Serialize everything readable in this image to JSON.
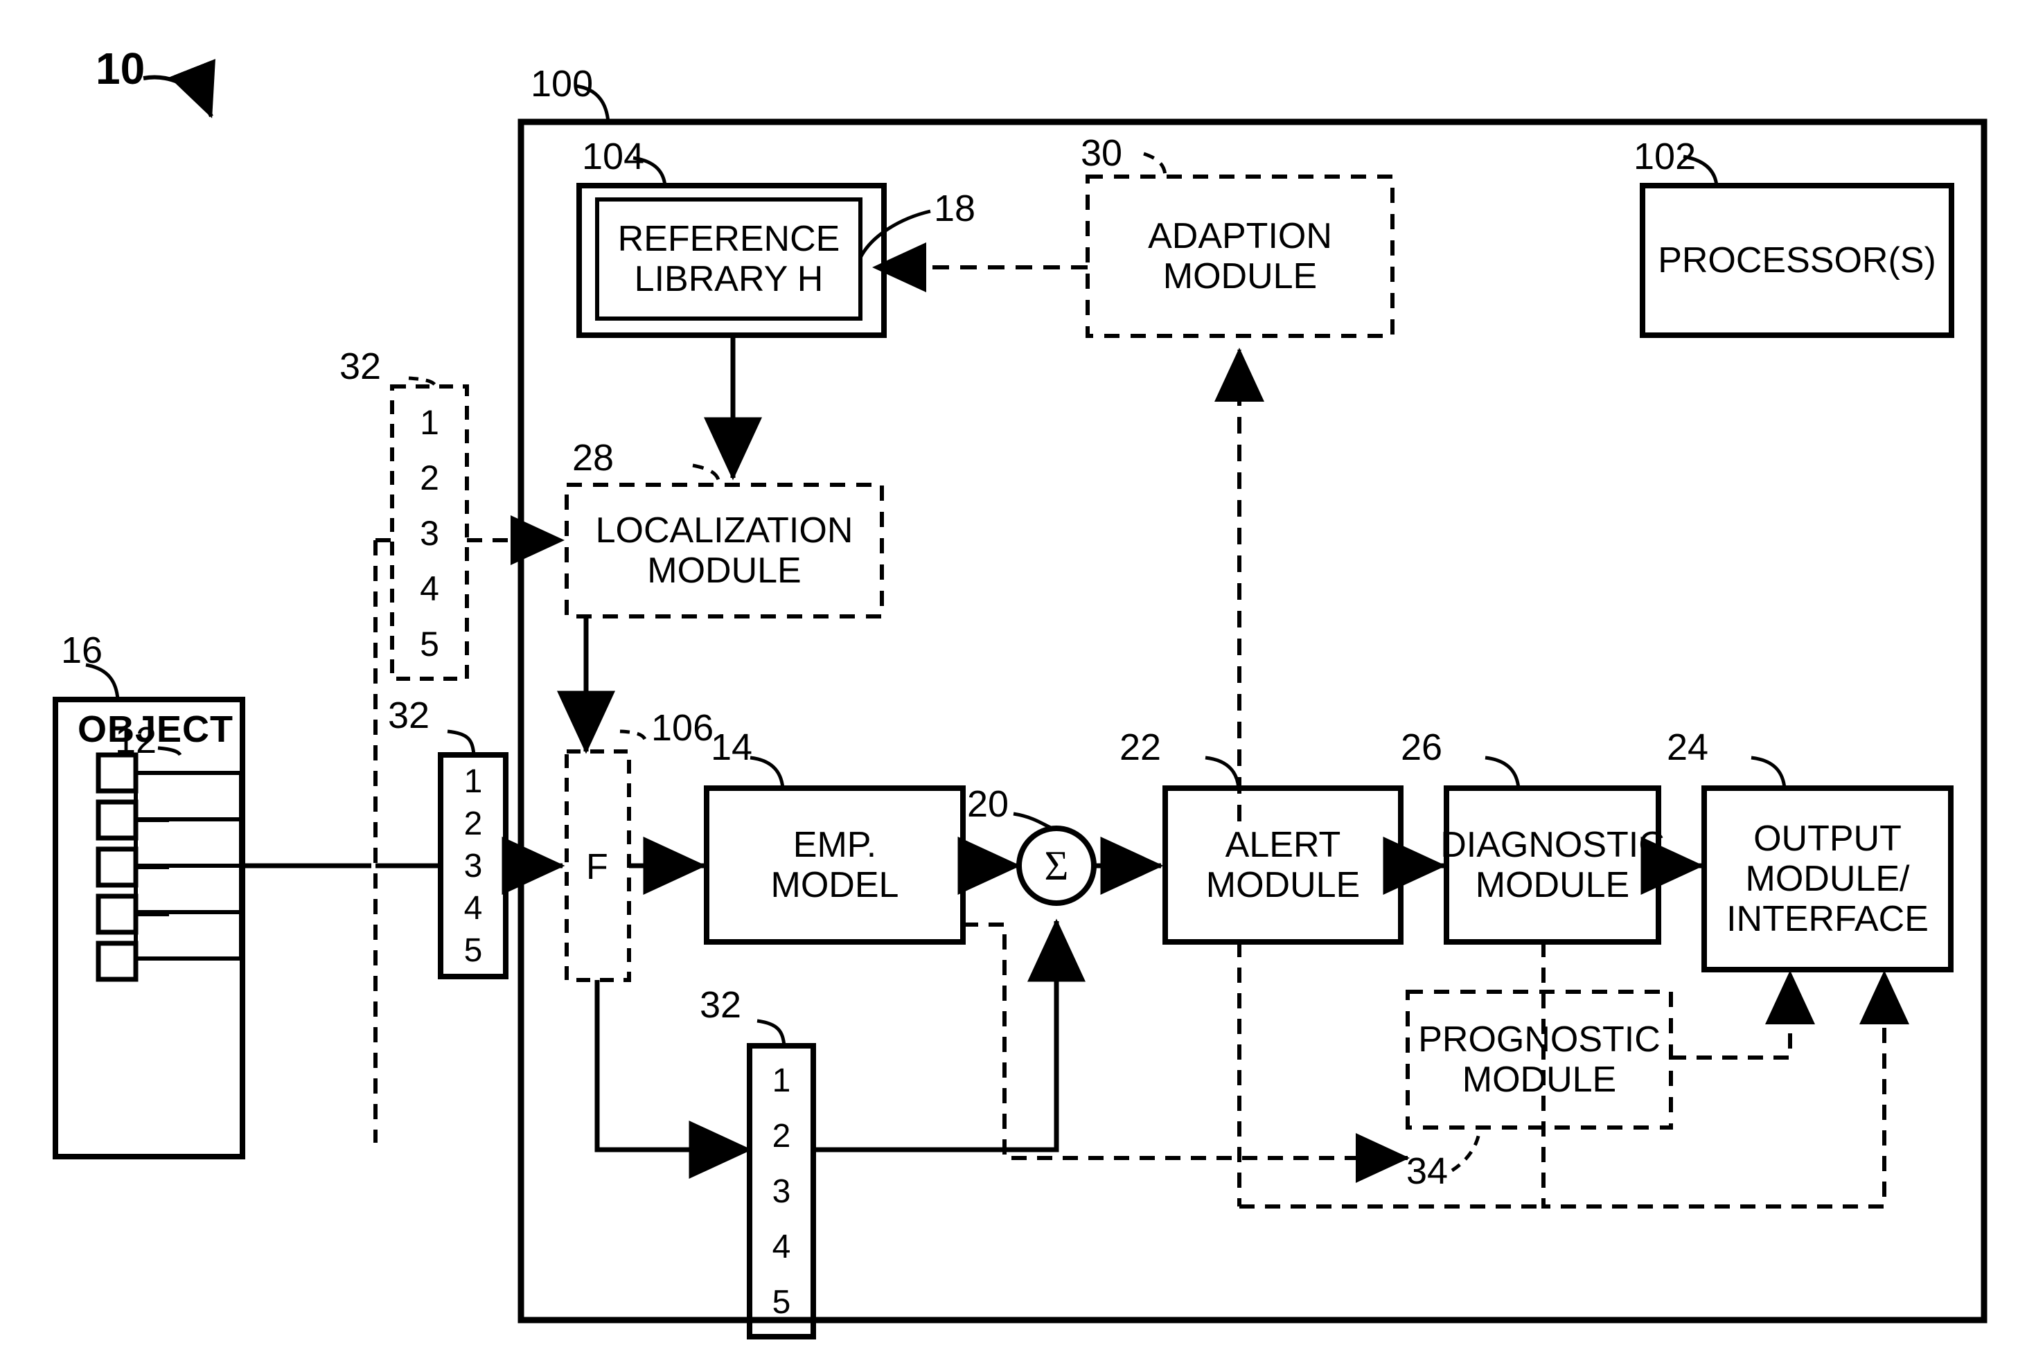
{
  "figure": {
    "system_ref": "10",
    "frame_ref": "100"
  },
  "frame": {
    "label_100": "100"
  },
  "blocks": {
    "reference_library": {
      "ref_outer": "104",
      "ref_inner": "18",
      "line1": "REFERENCE",
      "line2": "LIBRARY H"
    },
    "adaption_module": {
      "ref": "30",
      "line1": "ADAPTION",
      "line2": "MODULE"
    },
    "processor": {
      "ref": "102",
      "line1": "PROCESSOR(S)"
    },
    "localization_module": {
      "ref": "28",
      "line1": "LOCALIZATION",
      "line2": "MODULE"
    },
    "emp_model": {
      "ref": "14",
      "line1": "EMP.",
      "line2": "MODEL"
    },
    "summing_junction": {
      "ref": "20",
      "symbol": "Σ"
    },
    "alert_module": {
      "ref": "22",
      "line1": "ALERT",
      "line2": "MODULE"
    },
    "diagnostic_module": {
      "ref": "26",
      "line1": "DIAGNOSTIC",
      "line2": "MODULE"
    },
    "output_module": {
      "ref": "24",
      "line1": "OUTPUT",
      "line2": "MODULE/",
      "line3": "INTERFACE"
    },
    "prognostic_module": {
      "ref": "34",
      "line1": "PROGNOSTIC",
      "line2": "MODULE"
    },
    "object": {
      "ref": "16",
      "title": "OBJECT",
      "sensor_ref": "12",
      "sensor_count": 5
    },
    "filter_f": {
      "ref": "106",
      "label": "F"
    }
  },
  "signal_lists": {
    "upper_left": {
      "ref": "32",
      "items": [
        "1",
        "2",
        "3",
        "4",
        "5"
      ]
    },
    "middle_left": {
      "ref": "32",
      "items": [
        "1",
        "2",
        "3",
        "4",
        "5"
      ]
    },
    "lower_center": {
      "ref": "32",
      "items": [
        "1",
        "2",
        "3",
        "4",
        "5"
      ]
    }
  },
  "colors": {
    "ink": "#000000",
    "paper": "#ffffff"
  }
}
